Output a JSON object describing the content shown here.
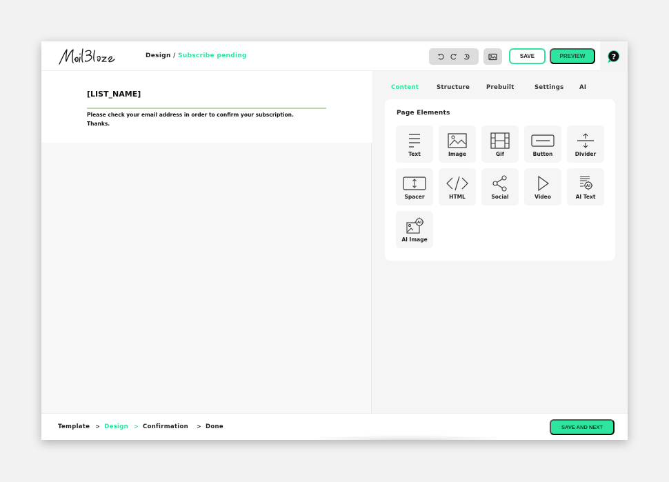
{
  "app": {
    "brand": "MailBlaze"
  },
  "header": {
    "breadcrumb_parent": "Design",
    "breadcrumb_separator": "/",
    "breadcrumb_current": "Subscribe pending",
    "save_label": "SAVE",
    "preview_label": "PREVIEW",
    "accent_color": "#2ee59d"
  },
  "email": {
    "title": "[LIST_NAME]",
    "line1": "Please check your email address in order to confirm your subscription.",
    "line2": "Thanks."
  },
  "panel": {
    "tabs": [
      {
        "label": "Content",
        "active": true
      },
      {
        "label": "Structure",
        "active": false
      },
      {
        "label": "Prebuilt",
        "active": false
      },
      {
        "label": "Settings",
        "active": false
      },
      {
        "label": "AI",
        "active": false
      }
    ],
    "section_title": "Page Elements",
    "elements": [
      {
        "label": "Text",
        "icon": "text-icon"
      },
      {
        "label": "Image",
        "icon": "image-icon"
      },
      {
        "label": "Gif",
        "icon": "gif-film-icon"
      },
      {
        "label": "Button",
        "icon": "button-icon"
      },
      {
        "label": "Divider",
        "icon": "divider-icon"
      },
      {
        "label": "Spacer",
        "icon": "spacer-icon"
      },
      {
        "label": "HTML",
        "icon": "code-icon"
      },
      {
        "label": "Social",
        "icon": "share-icon"
      },
      {
        "label": "Video",
        "icon": "play-icon"
      },
      {
        "label": "AI Text",
        "icon": "ai-text-icon"
      },
      {
        "label": "AI Image",
        "icon": "ai-image-icon"
      }
    ]
  },
  "footer": {
    "steps": [
      {
        "label": "Template",
        "current": false
      },
      {
        "label": "Design",
        "current": true
      },
      {
        "label": "Confirmation",
        "current": false
      },
      {
        "label": "Done",
        "current": false
      }
    ],
    "step_separator": ">",
    "save_next_label": "SAVE AND NEXT"
  }
}
